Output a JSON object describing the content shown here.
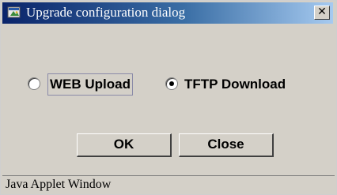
{
  "window": {
    "title": "Upgrade configuration dialog",
    "close_glyph": "✕"
  },
  "options": {
    "web_upload_label": "WEB Upload",
    "tftp_download_label": "TFTP Download",
    "selected": "TFTP Download"
  },
  "buttons": {
    "ok_label": "OK",
    "close_label": "Close"
  },
  "status": {
    "text": "Java Applet Window"
  },
  "icons": {
    "app": "java-applet-icon",
    "close": "close-icon"
  }
}
